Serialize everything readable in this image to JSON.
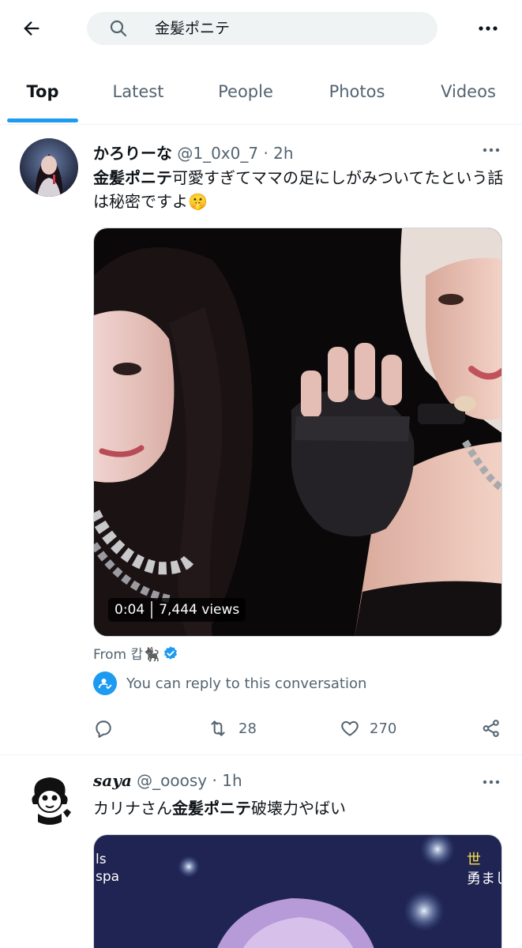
{
  "header": {
    "search_query": "金髪ポニテ"
  },
  "tabs": [
    {
      "label": "Top",
      "active": true
    },
    {
      "label": "Latest",
      "active": false
    },
    {
      "label": "People",
      "active": false
    },
    {
      "label": "Photos",
      "active": false
    },
    {
      "label": "Videos",
      "active": false
    }
  ],
  "posts": [
    {
      "display_name": "かろりーな",
      "handle": "@1_0x0_7",
      "time": "· 2h",
      "text_highlight": "金髪ポニテ",
      "text_rest": "可愛すぎてママの足にしがみついてたという話は秘密ですよ🤫",
      "video": {
        "duration": "0:04",
        "views": "7,444 views"
      },
      "from_label": "From 캅🐈‍⬛",
      "reply_note": "You can reply to this conversation",
      "actions": {
        "replies": "",
        "reposts": "28",
        "likes": "270"
      }
    },
    {
      "display_name": "saya",
      "handle": "@_ooosy",
      "time": "· 1h",
      "text_prefix": "カリナさん",
      "text_highlight": "金髪ポニテ",
      "text_rest": "破壊力やばい",
      "media_overlay": {
        "left_line1": "ls",
        "left_line2": "spa",
        "right_line1": "世",
        "right_line2": "勇まし"
      }
    }
  ],
  "colors": {
    "accent": "#1d9bf0",
    "text_primary": "#0f1419",
    "text_secondary": "#536471",
    "search_bg": "#eff3f4"
  }
}
